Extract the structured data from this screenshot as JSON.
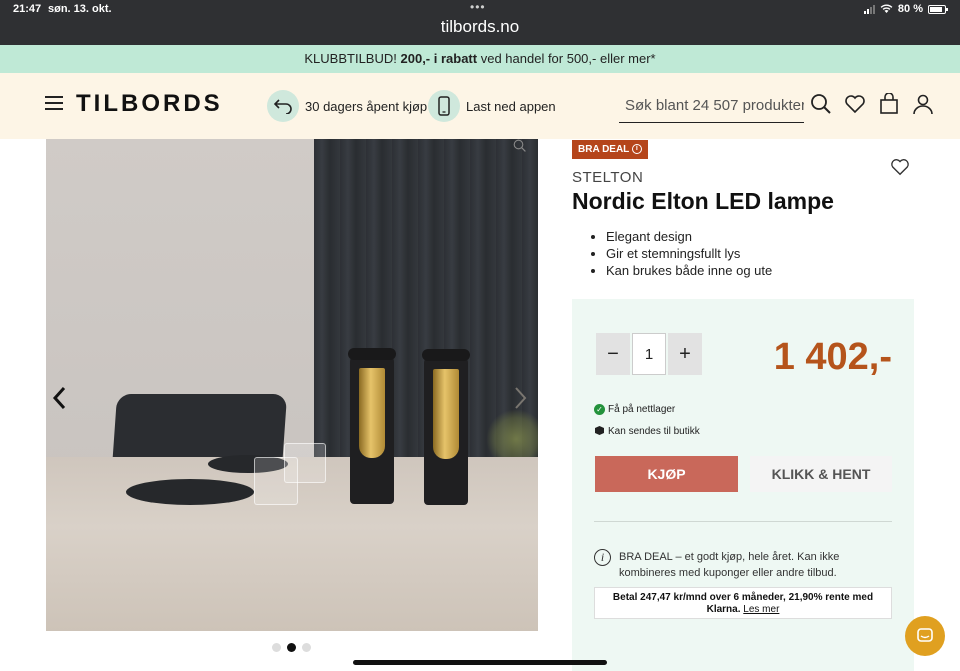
{
  "system": {
    "time": "21:47",
    "date": "søn. 13. okt.",
    "battery": "80 %",
    "url": "tilbords.no"
  },
  "promo": {
    "prefix": "KLUBBTILBUD!",
    "bold": "200,- i rabatt",
    "suffix": "ved handel for 500,- eller mer*"
  },
  "header": {
    "logo": "TILBORDS",
    "return_label": "30 dagers åpent kjøp",
    "app_label": "Last ned appen",
    "search_placeholder": "Søk blant 24 507 produkter"
  },
  "product": {
    "badge": "BRA DEAL",
    "brand": "STELTON",
    "title": "Nordic Elton LED lampe",
    "bullets": [
      "Elegant design",
      "Gir et stemningsfullt lys",
      "Kan brukes både inne og ute"
    ],
    "quantity": "1",
    "price": "1 402,-",
    "stock_online": "Få på nettlager",
    "stock_store": "Kan sendes til butikk",
    "buy_label": "KJØP",
    "pickup_label": "KLIKK & HENT",
    "deal_info": "BRA DEAL – et godt kjøp, hele året. Kan ikke kombineres med kuponger eller andre tilbud.",
    "klarna_line": "Betal 247,47 kr/mnd over 6 måneder, 21,90% rente med",
    "klarna_brand": "Klarna.",
    "klarna_link": "Les mer"
  },
  "gallery": {
    "slides": 3,
    "active_slide": 2
  },
  "colors": {
    "promo_bg": "#bfe9d6",
    "header_bg": "#fdf5e6",
    "accent": "#b5451b",
    "buy_bg": "#c9685a",
    "pricebox_bg": "#eef8f3"
  }
}
